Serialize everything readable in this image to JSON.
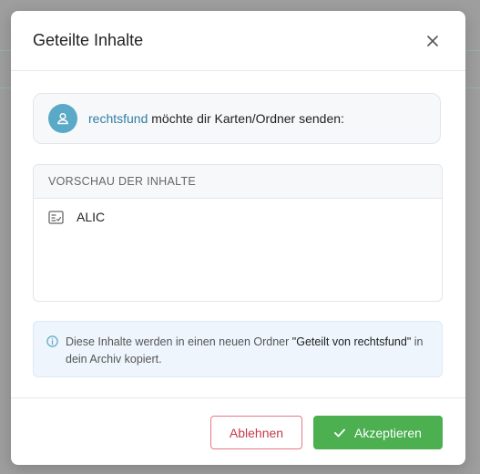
{
  "dialog": {
    "title": "Geteilte Inhalte",
    "close_icon": "close-icon"
  },
  "sender": {
    "name": "rechtsfund",
    "message": " möchte dir Karten/Ordner senden:",
    "avatar_icon": "user-icon"
  },
  "preview": {
    "header": "VORSCHAU DER INHALTE",
    "items": [
      {
        "icon": "card-icon",
        "label": "ALIC"
      }
    ]
  },
  "info": {
    "icon": "info-icon",
    "text_before": "Diese Inhalte werden in einen neuen Ordner ",
    "folder_name": "\"Geteilt von rechtsfund\"",
    "text_after": " in dein Archiv kopiert."
  },
  "footer": {
    "decline_label": "Ablehnen",
    "accept_label": "Akzeptieren",
    "accept_icon": "check-icon"
  },
  "colors": {
    "accent_green": "#4caf50",
    "decline_red": "#c43a4b",
    "sender_blue": "#2f7ea3",
    "avatar_blue": "#5aa9c7"
  }
}
